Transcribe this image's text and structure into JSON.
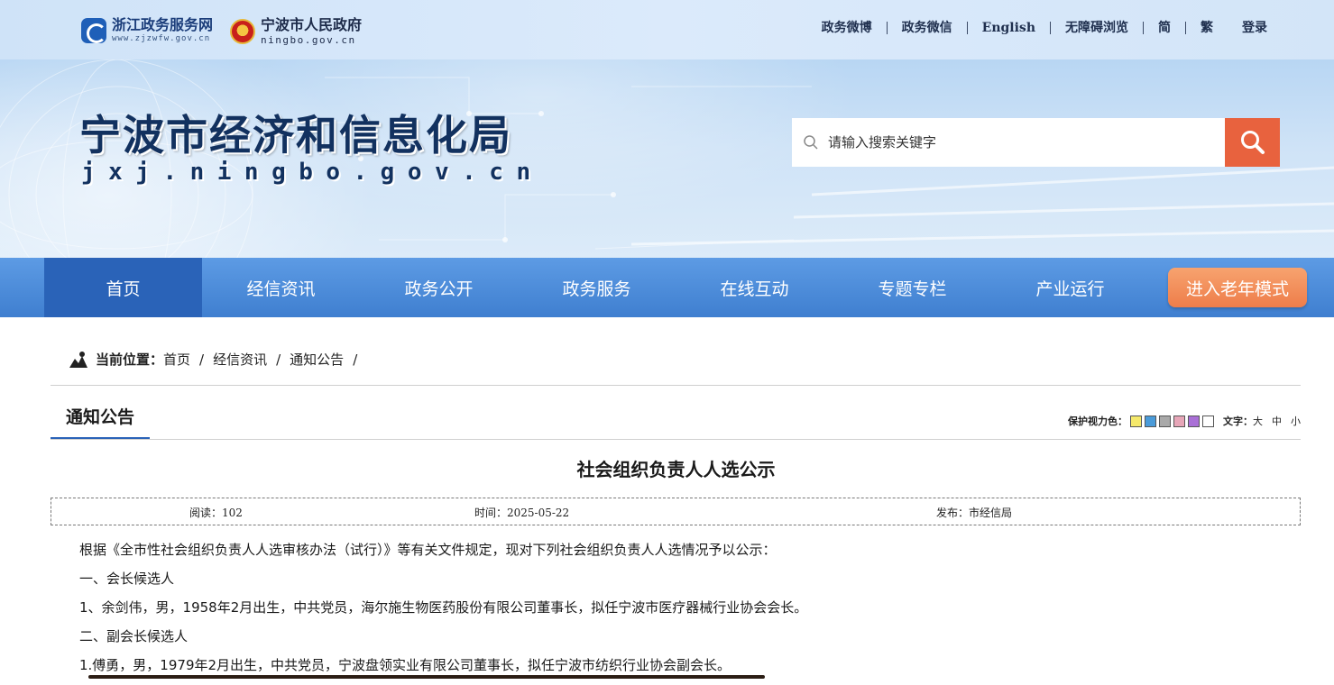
{
  "header": {
    "logo_zj": {
      "name": "浙江政务服务网",
      "domain": "www.zjzwfw.gov.cn"
    },
    "logo_nb": {
      "name": "宁波市人民政府",
      "domain": "ningbo.gov.cn"
    },
    "links": [
      "政务微博",
      "政务微信",
      "English",
      "无障碍浏览",
      "简",
      "繁",
      "登录"
    ]
  },
  "banner": {
    "title": "宁波市经济和信息化局",
    "domain": "jxj.ningbo.gov.cn",
    "search_placeholder": "请输入搜索关键字"
  },
  "nav": {
    "items": [
      "首页",
      "经信资讯",
      "政务公开",
      "政务服务",
      "在线互动",
      "专题专栏",
      "产业运行"
    ],
    "active_index": 0,
    "elder_mode": "进入老年模式"
  },
  "breadcrumb": {
    "lead": "当前位置：",
    "items": [
      "首页",
      "经信资讯",
      "通知公告"
    ]
  },
  "section": {
    "title": "通知公告",
    "color_label": "保护视力色：",
    "swatch_colors": [
      "#f5e96b",
      "#4a9bd9",
      "#a9a9a9",
      "#e7a6b8",
      "#a96fd6",
      "#ffffff"
    ],
    "font_label": "文字：",
    "font_sizes": [
      "大",
      "中",
      "小"
    ]
  },
  "article": {
    "title": "社会组织负责人人选公示",
    "meta": {
      "views": "阅读：102",
      "time": "时间：2025-05-22",
      "publisher": "发布：市经信局"
    },
    "paragraphs": [
      "根据《全市性社会组织负责人人选审核办法（试行）》等有关文件规定，现对下列社会组织负责人人选情况予以公示：",
      "一、会长候选人",
      "1、余剑伟，男，1958年2月出生，中共党员，海尔施生物医药股份有限公司董事长，拟任宁波市医疗器械行业协会会长。",
      "二、副会长候选人",
      "1.傅勇，男，1979年2月出生，中共党员，宁波盘领实业有限公司董事长，拟任宁波市纺织行业协会副会长。"
    ]
  },
  "colors": {
    "nav": "#4a88d8",
    "nav_active": "#2a63b8",
    "accent": "#e8623e",
    "title": "#12315f"
  }
}
